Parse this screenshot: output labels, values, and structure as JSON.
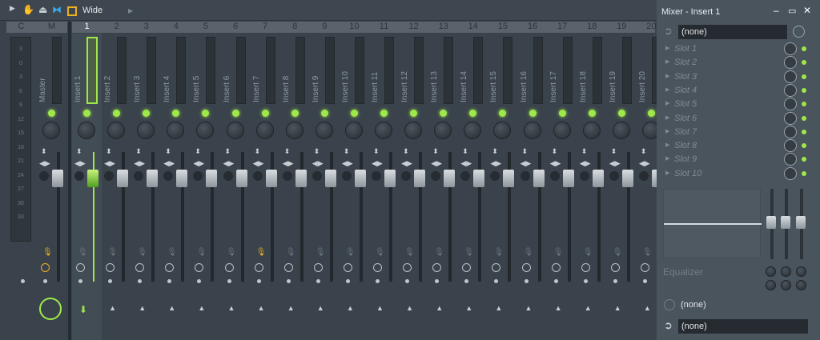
{
  "toolbar": {
    "view_mode": "Wide"
  },
  "header_cols": {
    "current": "C",
    "master": "M"
  },
  "master": {
    "name": "Master"
  },
  "meter_scale": [
    "3",
    "0",
    "3",
    "6",
    "9",
    "12",
    "15",
    "18",
    "21",
    "24",
    "27",
    "30",
    "33"
  ],
  "inserts": [
    {
      "num": "1",
      "name": "Insert 1",
      "selected": true
    },
    {
      "num": "2",
      "name": "Insert 2"
    },
    {
      "num": "3",
      "name": "Insert 3"
    },
    {
      "num": "4",
      "name": "Insert 4"
    },
    {
      "num": "5",
      "name": "Insert 5"
    },
    {
      "num": "6",
      "name": "Insert 6"
    },
    {
      "num": "7",
      "name": "Insert 7",
      "armed": true
    },
    {
      "num": "8",
      "name": "Insert 8"
    },
    {
      "num": "9",
      "name": "Insert 9"
    },
    {
      "num": "10",
      "name": "Insert 10"
    },
    {
      "num": "11",
      "name": "Insert 11"
    },
    {
      "num": "12",
      "name": "Insert 12"
    },
    {
      "num": "13",
      "name": "Insert 13"
    },
    {
      "num": "14",
      "name": "Insert 14"
    },
    {
      "num": "15",
      "name": "Insert 15"
    },
    {
      "num": "16",
      "name": "Insert 16"
    },
    {
      "num": "17",
      "name": "Insert 17"
    },
    {
      "num": "18",
      "name": "Insert 18"
    },
    {
      "num": "19",
      "name": "Insert 19"
    },
    {
      "num": "20",
      "name": "Insert 20"
    }
  ],
  "panel": {
    "title": "Mixer - Insert 1",
    "input": "(none)",
    "slots": [
      "Slot 1",
      "Slot 2",
      "Slot 3",
      "Slot 4",
      "Slot 5",
      "Slot 6",
      "Slot 7",
      "Slot 8",
      "Slot 9",
      "Slot 10"
    ],
    "eq_label": "Equalizer",
    "time_select": "(none)",
    "output": "(none)"
  },
  "colors": {
    "accent": "#9ee84a",
    "armed": "#f0b020"
  }
}
